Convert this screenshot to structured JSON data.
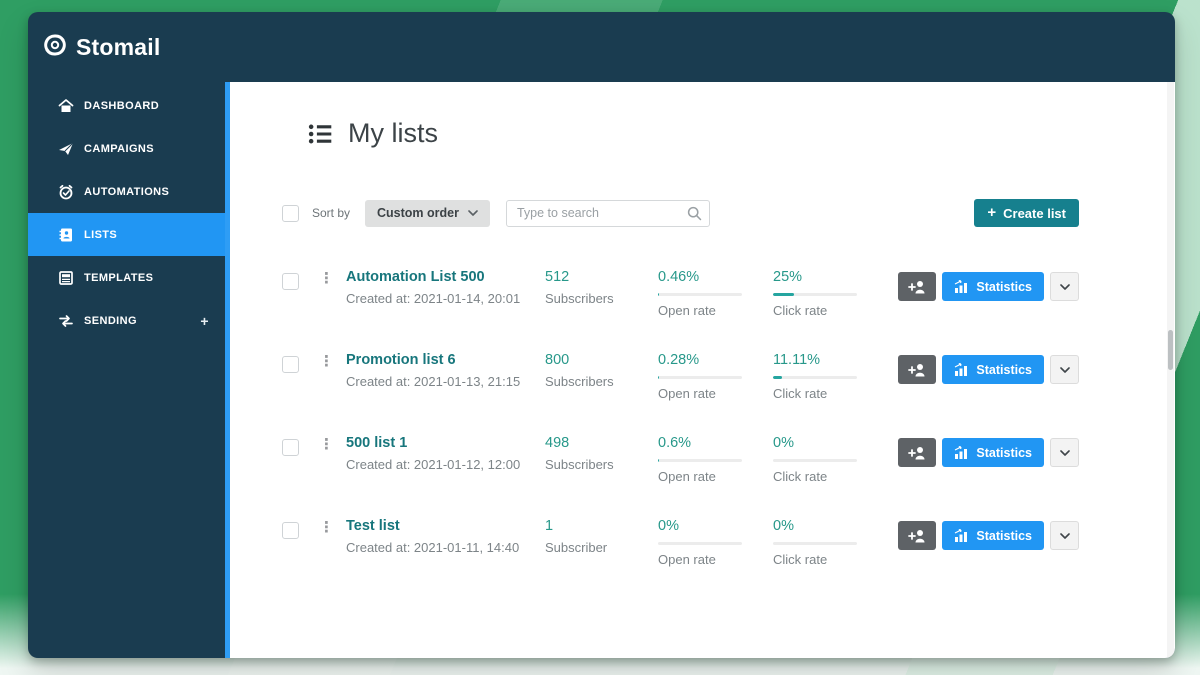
{
  "brand": {
    "name": "Stomail"
  },
  "sidebar": {
    "items": [
      {
        "label": "DASHBOARD",
        "icon": "home-icon",
        "active": false
      },
      {
        "label": "CAMPAIGNS",
        "icon": "paper-plane-icon",
        "active": false
      },
      {
        "label": "AUTOMATIONS",
        "icon": "alarm-clock-icon",
        "active": false
      },
      {
        "label": "LISTS",
        "icon": "address-book-icon",
        "active": true
      },
      {
        "label": "TEMPLATES",
        "icon": "template-icon",
        "active": false
      },
      {
        "label": "SENDING",
        "icon": "transfer-arrows-icon",
        "active": false,
        "trailing_plus": "+"
      }
    ]
  },
  "header": {
    "title": "My lists"
  },
  "toolbar": {
    "sort_by_label": "Sort by",
    "sort_value": "Custom order",
    "search_placeholder": "Type to search",
    "create_list_label": "Create list"
  },
  "icons": {
    "kebab": "⋮",
    "plus": "+"
  },
  "actions": {
    "statistics_label": "Statistics"
  },
  "table": {
    "labels": {
      "open": "Open rate",
      "click": "Click rate"
    },
    "rows": [
      {
        "name": "Automation List 500",
        "created": "Created at: 2021-01-14, 20:01",
        "subscribers": "512",
        "subscribers_label": "Subscribers",
        "open_value": "0.46%",
        "open_pct": 0.46,
        "click_value": "25%",
        "click_pct": 25
      },
      {
        "name": "Promotion list 6",
        "created": "Created at: 2021-01-13, 21:15",
        "subscribers": "800",
        "subscribers_label": "Subscribers",
        "open_value": "0.28%",
        "open_pct": 0.28,
        "click_value": "11.11%",
        "click_pct": 11.11
      },
      {
        "name": "500 list 1",
        "created": "Created at: 2021-01-12, 12:00",
        "subscribers": "498",
        "subscribers_label": "Subscribers",
        "open_value": "0.6%",
        "open_pct": 0.6,
        "click_value": "0%",
        "click_pct": 0
      },
      {
        "name": "Test list",
        "created": "Created at: 2021-01-11, 14:40",
        "subscribers": "1",
        "subscribers_label": "Subscriber",
        "open_value": "0%",
        "open_pct": 0,
        "click_value": "0%",
        "click_pct": 0
      }
    ]
  },
  "colors": {
    "background_green": "#2f9e63",
    "navy": "#1a3c50",
    "accent_blue": "#2196f3",
    "teal_button": "#16808e",
    "teal_text": "#17767c",
    "teal_value": "#27988a",
    "progress_fill": "#25a5a0"
  }
}
